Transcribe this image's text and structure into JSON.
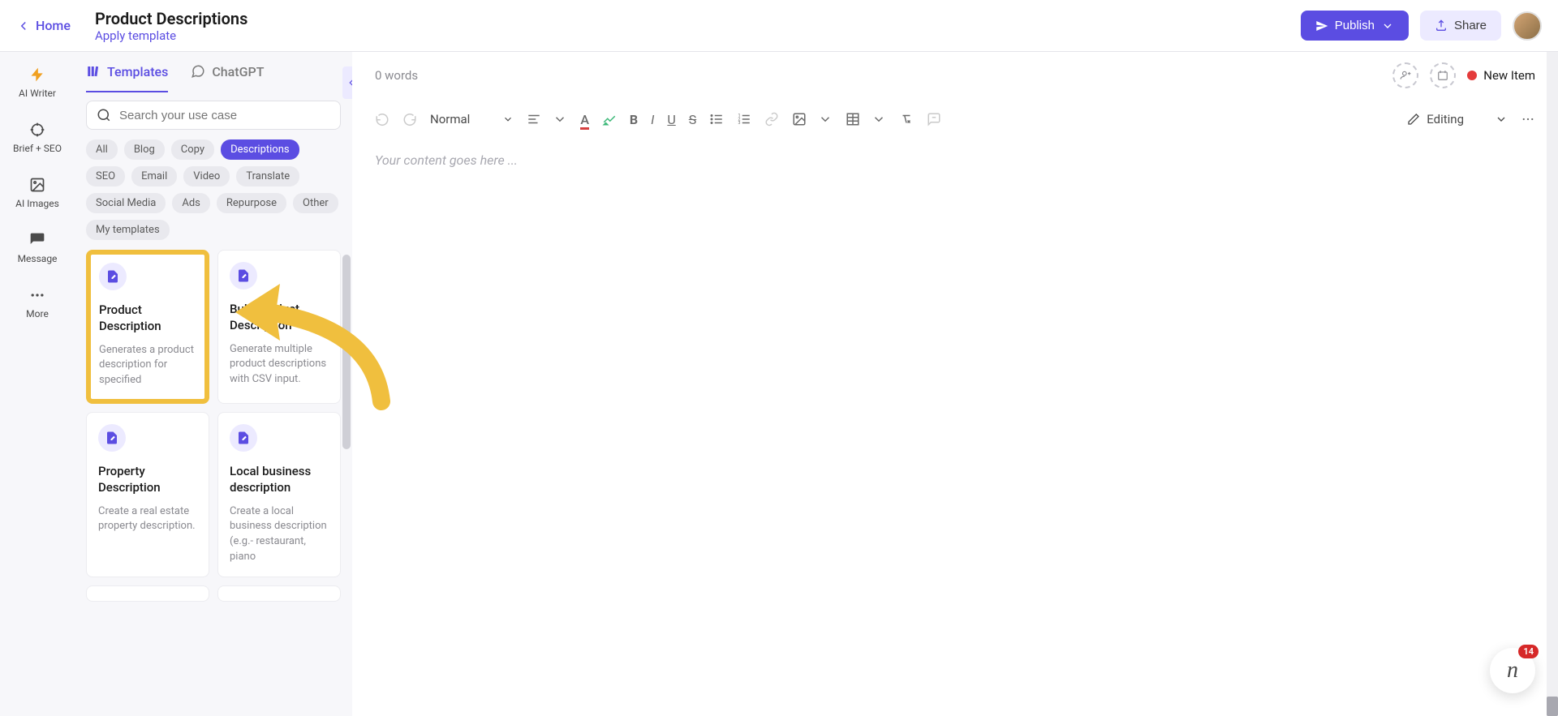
{
  "header": {
    "home_label": "Home",
    "page_title": "Product Descriptions",
    "apply_template": "Apply template",
    "publish_label": "Publish",
    "share_label": "Share"
  },
  "left_rail": {
    "items": [
      {
        "label": "AI Writer"
      },
      {
        "label": "Brief + SEO"
      },
      {
        "label": "AI Images"
      },
      {
        "label": "Message"
      },
      {
        "label": "More"
      }
    ]
  },
  "sidebar": {
    "tabs": [
      {
        "label": "Templates",
        "active": true
      },
      {
        "label": "ChatGPT",
        "active": false
      }
    ],
    "search_placeholder": "Search your use case",
    "filters": [
      {
        "label": "All",
        "active": false
      },
      {
        "label": "Blog",
        "active": false
      },
      {
        "label": "Copy",
        "active": false
      },
      {
        "label": "Descriptions",
        "active": true
      },
      {
        "label": "SEO",
        "active": false
      },
      {
        "label": "Email",
        "active": false
      },
      {
        "label": "Video",
        "active": false
      },
      {
        "label": "Translate",
        "active": false
      },
      {
        "label": "Social Media",
        "active": false
      },
      {
        "label": "Ads",
        "active": false
      },
      {
        "label": "Repurpose",
        "active": false
      },
      {
        "label": "Other",
        "active": false
      },
      {
        "label": "My templates",
        "active": false
      }
    ],
    "templates": [
      {
        "title": "Product Description",
        "desc": "Generates a product description for specified",
        "highlighted": true
      },
      {
        "title": "Bulk Product Description",
        "desc": "Generate multiple product descriptions with CSV input.",
        "highlighted": false
      },
      {
        "title": "Property Description",
        "desc": "Create a real estate property description.",
        "highlighted": false
      },
      {
        "title": "Local business description",
        "desc": "Create a local business description (e.g.- restaurant, piano",
        "highlighted": false
      }
    ]
  },
  "editor": {
    "word_count": "0 words",
    "new_item_label": "New Item",
    "format_select": "Normal",
    "editing_mode": "Editing",
    "placeholder": "Your content goes here ..."
  },
  "floating": {
    "badge": "14"
  },
  "colors": {
    "primary": "#5b4de2",
    "highlight_border": "#f0bf3e",
    "arrow": "#f0bf3e",
    "status_red": "#e43b3b",
    "badge_red": "#d62828"
  }
}
